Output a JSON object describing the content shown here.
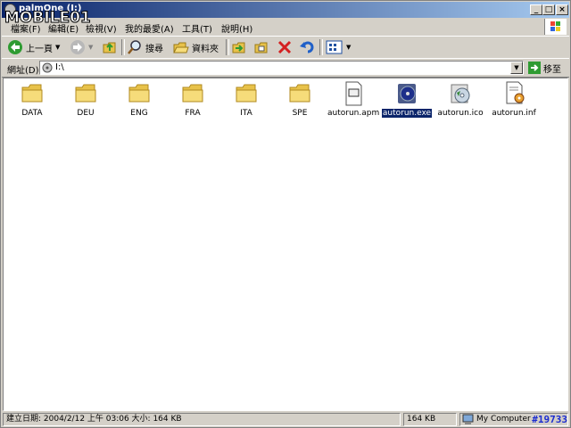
{
  "window": {
    "title": "palmOne (I:)"
  },
  "watermark": {
    "logo_text": "MOBILE01",
    "number": "#19733"
  },
  "menu": [
    "檔案(F)",
    "編輯(E)",
    "檢視(V)",
    "我的最愛(A)",
    "工具(T)",
    "說明(H)"
  ],
  "toolbar": {
    "back_label": "上一頁",
    "search_label": "搜尋",
    "folders_label": "資料夾"
  },
  "address": {
    "label": "網址(D)",
    "value": "I:\\",
    "go_label": "移至"
  },
  "files": [
    {
      "name": "DATA",
      "icon": "folder-icon"
    },
    {
      "name": "DEU",
      "icon": "folder-icon"
    },
    {
      "name": "ENG",
      "icon": "folder-icon"
    },
    {
      "name": "FRA",
      "icon": "folder-icon"
    },
    {
      "name": "ITA",
      "icon": "folder-icon"
    },
    {
      "name": "SPE",
      "icon": "folder-icon"
    },
    {
      "name": "autorun.apm",
      "icon": "document-icon"
    },
    {
      "name": "autorun.exe",
      "icon": "exe-disc-icon",
      "selected": true
    },
    {
      "name": "autorun.ico",
      "icon": "cd-icon"
    },
    {
      "name": "autorun.inf",
      "icon": "settings-file-icon"
    }
  ],
  "status": {
    "info": "建立日期: 2004/2/12 上午 03:06 大小: 164 KB",
    "size": "164 KB",
    "zone": "My Computer"
  },
  "colors": {
    "titlebar": "#0a246a",
    "selection": "#0a246a",
    "watermark": "#1a2bd0"
  }
}
